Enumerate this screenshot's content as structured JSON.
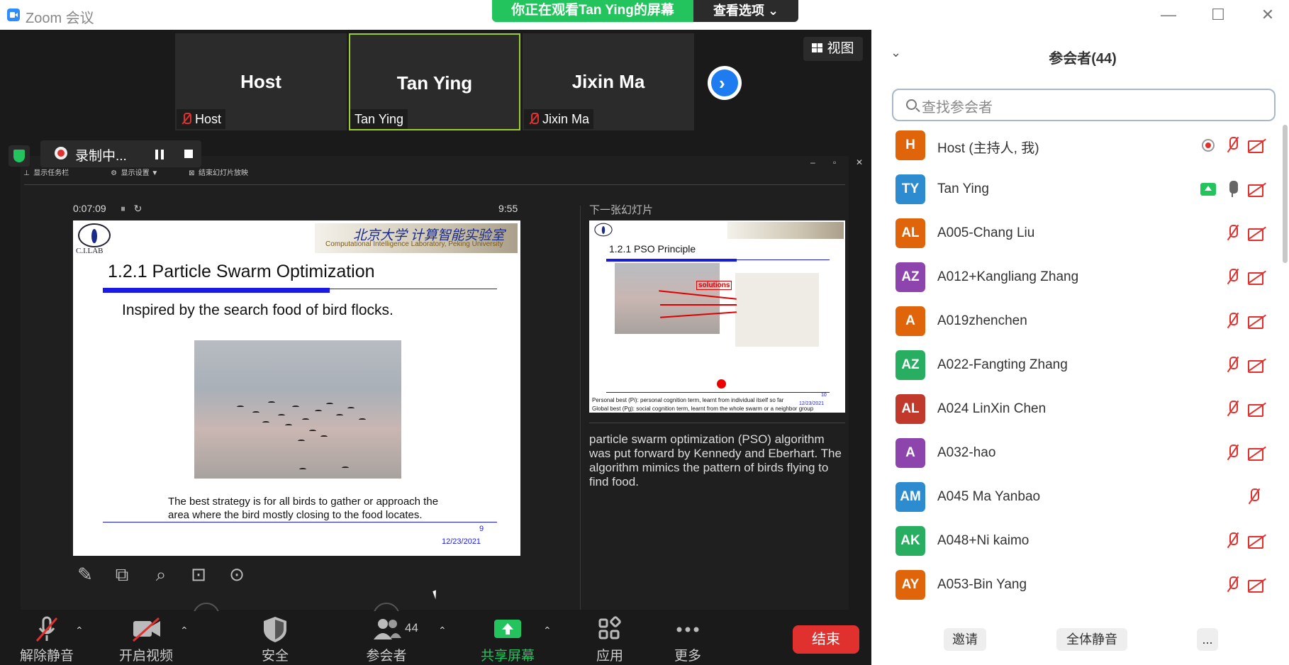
{
  "window": {
    "title": "Zoom 会议"
  },
  "banner": {
    "text": "你正在观看Tan Ying的屏幕",
    "view_options": "查看选项"
  },
  "tiles": [
    {
      "name": "Host",
      "label": "Host"
    },
    {
      "name": "Tan Ying",
      "label": "Tan Ying"
    },
    {
      "name": "Jixin Ma",
      "label": "Jixin Ma"
    }
  ],
  "view_button": "视图",
  "recording": {
    "text": "录制中..."
  },
  "presenter": {
    "toolbar": [
      "显示任务栏",
      "显示设置 ▼",
      "结束幻灯片放映"
    ],
    "timer": "0:07:09",
    "clock": "9:55",
    "next_label": "下一张幻灯片",
    "slide": {
      "logo": "C.I.LAB",
      "lab_cn": "北京大学 计算智能实验室",
      "lab_en": "Computational Intelligence Laboratory, Peking University",
      "title": "1.2.1 Particle Swarm Optimization",
      "subtitle": "Inspired by the search food of bird flocks.",
      "note_line1": "The best strategy is for all birds to gather or approach the",
      "note_line2": "area where the bird mostly closing to the food locates.",
      "number": "9",
      "date": "12/23/2021"
    },
    "next_slide": {
      "title": "1.2.1 PSO Principle",
      "solutions": "solutions",
      "foot1": "Personal best (Pi): personal cognition term, learnt from individual itself so far",
      "foot2": "Global best (Pg): social cognition term, learnt from the whole swarm or a neighbor group",
      "number": "10",
      "date": "12/23/2021"
    },
    "notes": "particle swarm optimization (PSO) algorithm was put forward by Kennedy and Eberhart. The algorithm mimics the pattern of birds flying to find food."
  },
  "toolbar": {
    "unmute": "解除静音",
    "start_video": "开启视频",
    "security": "安全",
    "participants": "参会者",
    "participants_count": "44",
    "share": "共享屏幕",
    "apps": "应用",
    "more": "更多",
    "end": "结束"
  },
  "panel": {
    "title": "参会者(44)",
    "search_placeholder": "查找参会者",
    "participants": [
      {
        "initials": "H",
        "name": "Host (主持人, 我)",
        "color": "#e0640a"
      },
      {
        "initials": "TY",
        "name": "Tan Ying",
        "color": "#2d8ccf"
      },
      {
        "initials": "AL",
        "name": "A005-Chang Liu",
        "color": "#e0640a"
      },
      {
        "initials": "AZ",
        "name": "A012+Kangliang Zhang",
        "color": "#8e44ad"
      },
      {
        "initials": "A",
        "name": "A019zhenchen",
        "color": "#e0640a"
      },
      {
        "initials": "AZ",
        "name": "A022-Fangting Zhang",
        "color": "#27ae60"
      },
      {
        "initials": "AL",
        "name": "A024 LinXin Chen",
        "color": "#c0392b"
      },
      {
        "initials": "A",
        "name": "A032-hao",
        "color": "#8e44ad"
      },
      {
        "initials": "AM",
        "name": "A045 Ma Yanbao",
        "color": "#2d8ccf"
      },
      {
        "initials": "AK",
        "name": "A048+Ni kaimo",
        "color": "#27ae60"
      },
      {
        "initials": "AY",
        "name": "A053-Bin Yang",
        "color": "#e0640a"
      }
    ],
    "invite": "邀请",
    "mute_all": "全体静音",
    "more": "..."
  },
  "colors": {
    "accent": "#2d8cff",
    "green": "#23c45e",
    "red": "#e0312f"
  }
}
